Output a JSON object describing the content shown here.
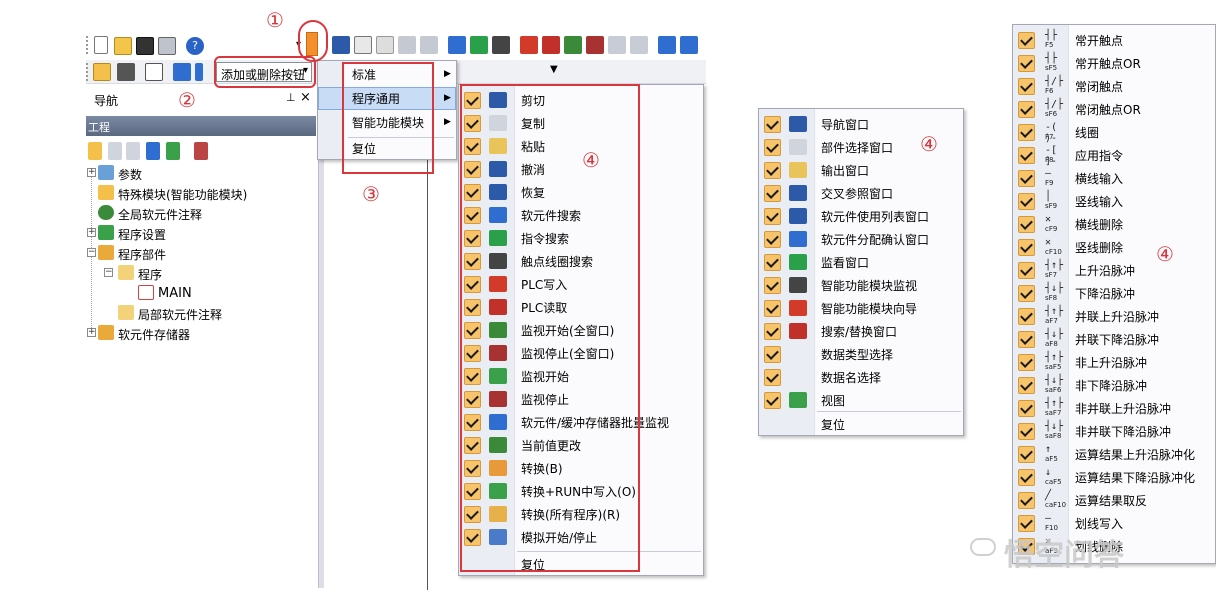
{
  "annotations": [
    "①",
    "②",
    "③",
    "④",
    "④",
    "④"
  ],
  "toolbar": {
    "add_remove_label": "添加或删除按钮",
    "std_icons": [
      "new-file-icon",
      "open-folder-icon",
      "save-icon",
      "print-icon",
      "help-icon"
    ],
    "edit_icons": [
      "cut-icon",
      "copy-icon",
      "paste-icon",
      "undo-icon",
      "redo-icon",
      "device-search-icon",
      "instruction-search-icon",
      "contact-coil-search-icon",
      "plc-write-icon",
      "plc-read-icon",
      "monitor-start-all-icon",
      "monitor-stop-all-icon",
      "monitor-start-icon",
      "monitor-stop-icon",
      "batch-monitor-icon",
      "current-value-icon"
    ]
  },
  "navigation": {
    "title": "导航",
    "pin": "ᵖ",
    "close": "×",
    "section": "工程",
    "tree": [
      {
        "label": "参数",
        "icon": "parameter-icon"
      },
      {
        "label": "特殊模块(智能功能模块)",
        "icon": "special-module-icon"
      },
      {
        "label": "全局软元件注释",
        "icon": "global-comment-icon"
      },
      {
        "label": "程序设置",
        "icon": "program-setting-icon"
      },
      {
        "label": "程序部件",
        "icon": "program-parts-icon"
      },
      {
        "label": "程序",
        "icon": "program-folder-icon"
      },
      {
        "label": "MAIN",
        "icon": "main-program-icon"
      },
      {
        "label": "局部软元件注释",
        "icon": "local-comment-icon"
      },
      {
        "label": "软元件存储器",
        "icon": "device-memory-icon"
      }
    ]
  },
  "submenu": {
    "items": [
      "标准",
      "程序通用",
      "智能功能模块",
      "复位"
    ]
  },
  "menu_common": {
    "items": [
      "剪切",
      "复制",
      "粘贴",
      "撤消",
      "恢复",
      "软元件搜索",
      "指令搜索",
      "触点线圈搜索",
      "PLC写入",
      "PLC读取",
      "监视开始(全窗口)",
      "监视停止(全窗口)",
      "监视开始",
      "监视停止",
      "软元件/缓冲存储器批量监视",
      "当前值更改",
      "转换(B)",
      "转换+RUN中写入(O)",
      "转换(所有程序)(R)",
      "模拟开始/停止"
    ],
    "icons": [
      "cut-icon",
      "copy-icon",
      "paste-icon",
      "undo-icon",
      "redo-icon",
      "device-search-icon",
      "instruction-search-icon",
      "contact-coil-search-icon",
      "plc-write-icon",
      "plc-read-icon",
      "monitor-start-all-icon",
      "monitor-stop-all-icon",
      "monitor-start-icon",
      "monitor-stop-icon",
      "batch-monitor-icon",
      "current-value-icon",
      "convert-icon",
      "convert-run-write-icon",
      "convert-all-icon",
      "simulation-icon"
    ],
    "reset": "复位"
  },
  "menu_window": {
    "items": [
      "导航窗口",
      "部件选择窗口",
      "输出窗口",
      "交叉参照窗口",
      "软元件使用列表窗口",
      "软元件分配确认窗口",
      "监看窗口",
      "智能功能模块监视",
      "智能功能模块向导",
      "搜索/替换窗口",
      "数据类型选择",
      "数据名选择",
      "视图"
    ],
    "icons": [
      "navigation-window-icon",
      "parts-window-icon",
      "output-window-icon",
      "cross-reference-icon",
      "device-list-icon",
      "device-assign-icon",
      "watch-window-icon",
      "module-monitor-icon",
      "module-wizard-icon",
      "find-replace-icon",
      "",
      "",
      "view-icon"
    ],
    "reset": "复位"
  },
  "menu_ladder": {
    "items": [
      "常开触点",
      "常开触点OR",
      "常闭触点",
      "常闭触点OR",
      "线圈",
      "应用指令",
      "横线输入",
      "竖线输入",
      "横线删除",
      "竖线删除",
      "上升沿脉冲",
      "下降沿脉冲",
      "并联上升沿脉冲",
      "并联下降沿脉冲",
      "非上升沿脉冲",
      "非下降沿脉冲",
      "非并联上升沿脉冲",
      "非并联下降沿脉冲",
      "运算结果上升沿脉冲化",
      "运算结果下降沿脉冲化",
      "运算结果取反",
      "划线写入",
      "划线删除"
    ],
    "symbols": [
      "┤├",
      "┤├",
      "┤/├",
      "┤/├",
      "-( )-",
      "-[ ]-",
      "—",
      "│",
      "✕",
      "✕",
      "┤↑├",
      "┤↓├",
      "┤↑├",
      "┤↓├",
      "┤↑├",
      "┤↓├",
      "┤↑├",
      "┤↓├",
      "↑",
      "↓",
      "╱",
      "—",
      "✕"
    ],
    "keys": [
      "F5",
      "sF5",
      "F6",
      "sF6",
      "F7",
      "F8",
      "F9",
      "sF9",
      "cF9",
      "cF10",
      "sF7",
      "sF8",
      "aF7",
      "aF8",
      "saF5",
      "saF6",
      "saF7",
      "saF8",
      "aF5",
      "caF5",
      "caF10",
      "F10",
      "aF9"
    ]
  },
  "watermark": "悟空问答"
}
